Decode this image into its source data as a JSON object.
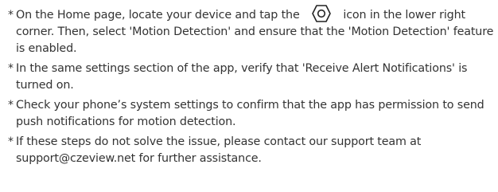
{
  "bullet_symbol": "*",
  "items": [
    {
      "before": "On the Home page, locate your device and tap the ",
      "icon": "settings-hexagon-icon",
      "after": " icon in the lower right corner. Then, select 'Motion Detection' and ensure that the 'Motion Detection' feature is enabled."
    },
    {
      "text": "In the same settings section of the app, verify that 'Receive Alert Notifications' is turned on."
    },
    {
      "text": "Check your phone’s system settings to confirm that the app has permission to send push notifications for motion detection."
    },
    {
      "text": "If these steps do not solve the issue, please contact our support team at support@czeview.net for further assistance."
    }
  ],
  "colors": {
    "text": "#333333",
    "icon_stroke": "#222222"
  }
}
